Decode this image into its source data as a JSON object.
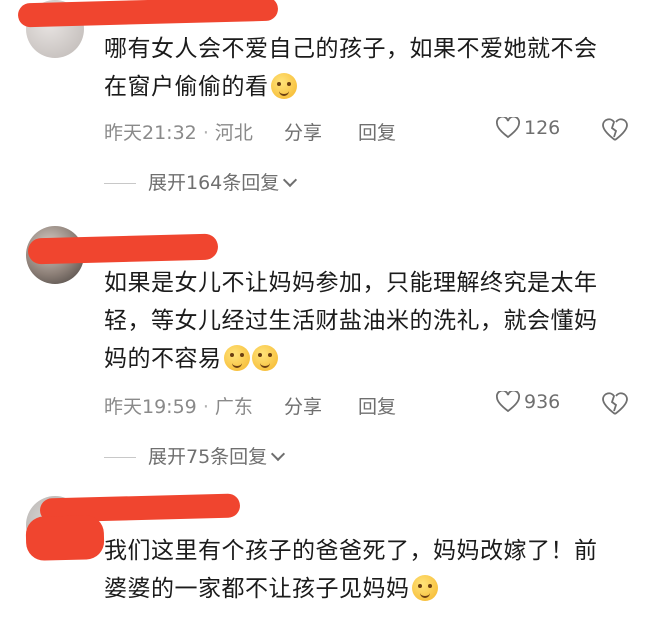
{
  "comments": [
    {
      "text_lines": [
        "哪有女人会不爱自己的孩子，如果不爱她就不会",
        "在窗户偷偷的看"
      ],
      "time": "昨天21:32",
      "location": "河北",
      "share_label": "分享",
      "reply_label": "回复",
      "likes": "126",
      "expand_label": "展开164条回复",
      "emoji": [
        "pleading-face-emoji"
      ]
    },
    {
      "text_lines": [
        "如果是女儿不让妈妈参加，只能理解终究是太年",
        "轻，等女儿经过生活财盐油米的洗礼，就会懂妈",
        "妈的不容易"
      ],
      "time": "昨天19:59",
      "location": "广东",
      "share_label": "分享",
      "reply_label": "回复",
      "likes": "936",
      "expand_label": "展开75条回复",
      "emoji": [
        "laughing-tears-emoji",
        "laughing-tears-emoji"
      ]
    },
    {
      "text_lines": [
        "我们这里有个孩子的爸爸死了，妈妈改嫁了！前",
        "婆婆的一家都不让孩子见妈妈"
      ],
      "emoji": [
        "shushing-face-emoji"
      ]
    }
  ],
  "meta_separator": "·",
  "colors": {
    "redaction": "#f0452f",
    "meta_text": "#8a8a8a"
  }
}
